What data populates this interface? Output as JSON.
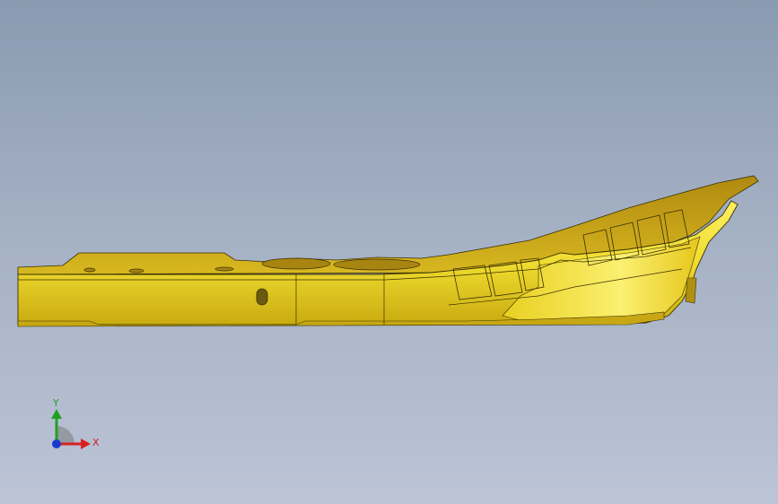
{
  "viewport": {
    "background_top": "#8a9ab0",
    "background_bottom": "#bcc4d6"
  },
  "model": {
    "part_color": "#e8d21c",
    "edge_color": "#3a3000"
  },
  "triad": {
    "x_label": "X",
    "y_label": "Y",
    "x_color": "#d62020",
    "y_color": "#22a022",
    "z_color": "#1a3ccc"
  }
}
